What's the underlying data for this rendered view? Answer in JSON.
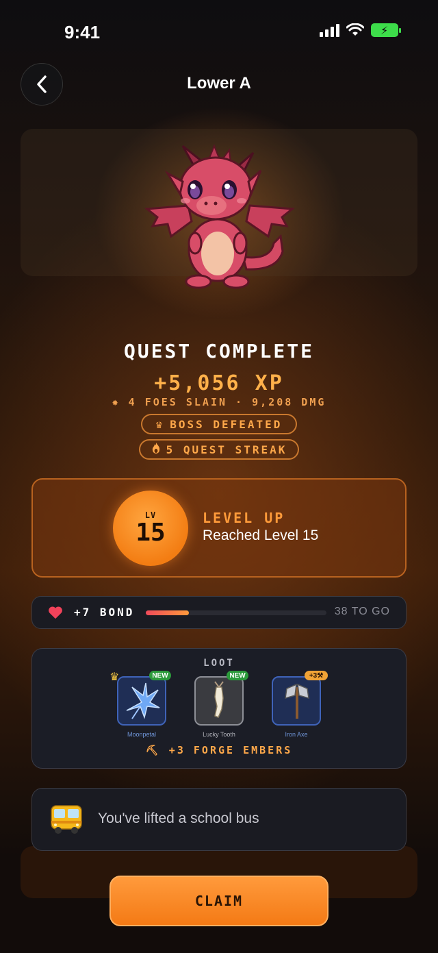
{
  "status_bar": {
    "time": "9:41"
  },
  "header": {
    "title": "Lower A"
  },
  "result": {
    "title": "QUEST COMPLETE",
    "xp": "+5,056 XP",
    "stats_line": "4 FOES SLAIN · 9,208 DMG",
    "badges": [
      {
        "label": "BOSS DEFEATED",
        "icon": "crown-icon"
      },
      {
        "label": "5 QUEST STREAK",
        "icon": "flame-icon"
      }
    ]
  },
  "level": {
    "lv_label": "LV",
    "number": "15",
    "title": "LEVEL UP",
    "subtitle": "Reached Level 15"
  },
  "bond": {
    "label": "+7 BOND",
    "remaining": "38 TO GO",
    "progress": 0.24
  },
  "loot": {
    "title": "LOOT",
    "items": [
      {
        "name": "Moonpetal",
        "badge": "NEW",
        "icon": "moonpetal-icon"
      },
      {
        "name": "Lucky Tooth",
        "badge": "NEW",
        "icon": "tooth-icon"
      },
      {
        "name": "Iron Axe",
        "badge": "+3",
        "icon": "axe-icon"
      }
    ],
    "forge": "+3 FORGE EMBERS"
  },
  "milestone": {
    "text": "You've lifted a school bus",
    "icon": "school-bus-icon"
  },
  "claim_button": {
    "label": "CLAIM"
  },
  "colors": {
    "accent": "#f47a15",
    "gold": "#ffb14a",
    "new_badge": "#2c9a3b"
  }
}
